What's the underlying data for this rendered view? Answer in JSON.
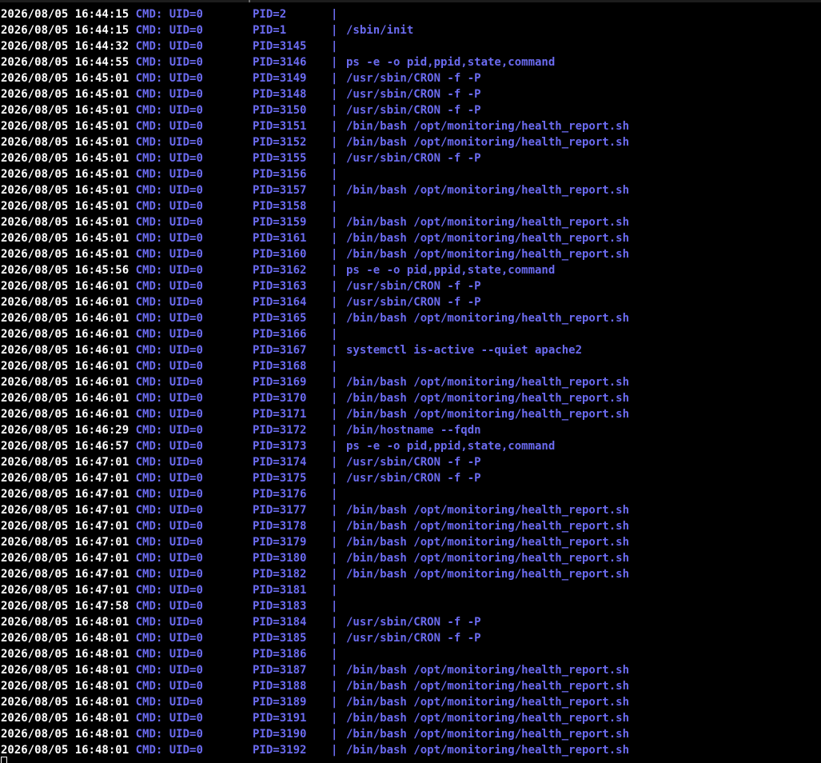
{
  "terminal": {
    "cmd_label": "CMD:",
    "separator": "|",
    "lines": [
      {
        "timestamp": "2026/08/05 16:44:15",
        "uid": "UID=0",
        "pid": "PID=2",
        "command": ""
      },
      {
        "timestamp": "2026/08/05 16:44:15",
        "uid": "UID=0",
        "pid": "PID=1",
        "command": "/sbin/init"
      },
      {
        "timestamp": "2026/08/05 16:44:32",
        "uid": "UID=0",
        "pid": "PID=3145",
        "command": ""
      },
      {
        "timestamp": "2026/08/05 16:44:55",
        "uid": "UID=0",
        "pid": "PID=3146",
        "command": "ps -e -o pid,ppid,state,command"
      },
      {
        "timestamp": "2026/08/05 16:45:01",
        "uid": "UID=0",
        "pid": "PID=3149",
        "command": "/usr/sbin/CRON -f -P"
      },
      {
        "timestamp": "2026/08/05 16:45:01",
        "uid": "UID=0",
        "pid": "PID=3148",
        "command": "/usr/sbin/CRON -f -P"
      },
      {
        "timestamp": "2026/08/05 16:45:01",
        "uid": "UID=0",
        "pid": "PID=3150",
        "command": "/usr/sbin/CRON -f -P"
      },
      {
        "timestamp": "2026/08/05 16:45:01",
        "uid": "UID=0",
        "pid": "PID=3151",
        "command": "/bin/bash /opt/monitoring/health_report.sh"
      },
      {
        "timestamp": "2026/08/05 16:45:01",
        "uid": "UID=0",
        "pid": "PID=3152",
        "command": "/bin/bash /opt/monitoring/health_report.sh"
      },
      {
        "timestamp": "2026/08/05 16:45:01",
        "uid": "UID=0",
        "pid": "PID=3155",
        "command": "/usr/sbin/CRON -f -P"
      },
      {
        "timestamp": "2026/08/05 16:45:01",
        "uid": "UID=0",
        "pid": "PID=3156",
        "command": ""
      },
      {
        "timestamp": "2026/08/05 16:45:01",
        "uid": "UID=0",
        "pid": "PID=3157",
        "command": "/bin/bash /opt/monitoring/health_report.sh"
      },
      {
        "timestamp": "2026/08/05 16:45:01",
        "uid": "UID=0",
        "pid": "PID=3158",
        "command": ""
      },
      {
        "timestamp": "2026/08/05 16:45:01",
        "uid": "UID=0",
        "pid": "PID=3159",
        "command": "/bin/bash /opt/monitoring/health_report.sh"
      },
      {
        "timestamp": "2026/08/05 16:45:01",
        "uid": "UID=0",
        "pid": "PID=3161",
        "command": "/bin/bash /opt/monitoring/health_report.sh"
      },
      {
        "timestamp": "2026/08/05 16:45:01",
        "uid": "UID=0",
        "pid": "PID=3160",
        "command": "/bin/bash /opt/monitoring/health_report.sh"
      },
      {
        "timestamp": "2026/08/05 16:45:56",
        "uid": "UID=0",
        "pid": "PID=3162",
        "command": "ps -e -o pid,ppid,state,command"
      },
      {
        "timestamp": "2026/08/05 16:46:01",
        "uid": "UID=0",
        "pid": "PID=3163",
        "command": "/usr/sbin/CRON -f -P"
      },
      {
        "timestamp": "2026/08/05 16:46:01",
        "uid": "UID=0",
        "pid": "PID=3164",
        "command": "/usr/sbin/CRON -f -P"
      },
      {
        "timestamp": "2026/08/05 16:46:01",
        "uid": "UID=0",
        "pid": "PID=3165",
        "command": "/bin/bash /opt/monitoring/health_report.sh"
      },
      {
        "timestamp": "2026/08/05 16:46:01",
        "uid": "UID=0",
        "pid": "PID=3166",
        "command": ""
      },
      {
        "timestamp": "2026/08/05 16:46:01",
        "uid": "UID=0",
        "pid": "PID=3167",
        "command": "systemctl is-active --quiet apache2"
      },
      {
        "timestamp": "2026/08/05 16:46:01",
        "uid": "UID=0",
        "pid": "PID=3168",
        "command": ""
      },
      {
        "timestamp": "2026/08/05 16:46:01",
        "uid": "UID=0",
        "pid": "PID=3169",
        "command": "/bin/bash /opt/monitoring/health_report.sh"
      },
      {
        "timestamp": "2026/08/05 16:46:01",
        "uid": "UID=0",
        "pid": "PID=3170",
        "command": "/bin/bash /opt/monitoring/health_report.sh"
      },
      {
        "timestamp": "2026/08/05 16:46:01",
        "uid": "UID=0",
        "pid": "PID=3171",
        "command": "/bin/bash /opt/monitoring/health_report.sh"
      },
      {
        "timestamp": "2026/08/05 16:46:29",
        "uid": "UID=0",
        "pid": "PID=3172",
        "command": "/bin/hostname --fqdn"
      },
      {
        "timestamp": "2026/08/05 16:46:57",
        "uid": "UID=0",
        "pid": "PID=3173",
        "command": "ps -e -o pid,ppid,state,command"
      },
      {
        "timestamp": "2026/08/05 16:47:01",
        "uid": "UID=0",
        "pid": "PID=3174",
        "command": "/usr/sbin/CRON -f -P"
      },
      {
        "timestamp": "2026/08/05 16:47:01",
        "uid": "UID=0",
        "pid": "PID=3175",
        "command": "/usr/sbin/CRON -f -P"
      },
      {
        "timestamp": "2026/08/05 16:47:01",
        "uid": "UID=0",
        "pid": "PID=3176",
        "command": ""
      },
      {
        "timestamp": "2026/08/05 16:47:01",
        "uid": "UID=0",
        "pid": "PID=3177",
        "command": "/bin/bash /opt/monitoring/health_report.sh"
      },
      {
        "timestamp": "2026/08/05 16:47:01",
        "uid": "UID=0",
        "pid": "PID=3178",
        "command": "/bin/bash /opt/monitoring/health_report.sh"
      },
      {
        "timestamp": "2026/08/05 16:47:01",
        "uid": "UID=0",
        "pid": "PID=3179",
        "command": "/bin/bash /opt/monitoring/health_report.sh"
      },
      {
        "timestamp": "2026/08/05 16:47:01",
        "uid": "UID=0",
        "pid": "PID=3180",
        "command": "/bin/bash /opt/monitoring/health_report.sh"
      },
      {
        "timestamp": "2026/08/05 16:47:01",
        "uid": "UID=0",
        "pid": "PID=3182",
        "command": "/bin/bash /opt/monitoring/health_report.sh"
      },
      {
        "timestamp": "2026/08/05 16:47:01",
        "uid": "UID=0",
        "pid": "PID=3181",
        "command": ""
      },
      {
        "timestamp": "2026/08/05 16:47:58",
        "uid": "UID=0",
        "pid": "PID=3183",
        "command": ""
      },
      {
        "timestamp": "2026/08/05 16:48:01",
        "uid": "UID=0",
        "pid": "PID=3184",
        "command": "/usr/sbin/CRON -f -P"
      },
      {
        "timestamp": "2026/08/05 16:48:01",
        "uid": "UID=0",
        "pid": "PID=3185",
        "command": "/usr/sbin/CRON -f -P"
      },
      {
        "timestamp": "2026/08/05 16:48:01",
        "uid": "UID=0",
        "pid": "PID=3186",
        "command": ""
      },
      {
        "timestamp": "2026/08/05 16:48:01",
        "uid": "UID=0",
        "pid": "PID=3187",
        "command": "/bin/bash /opt/monitoring/health_report.sh"
      },
      {
        "timestamp": "2026/08/05 16:48:01",
        "uid": "UID=0",
        "pid": "PID=3188",
        "command": "/bin/bash /opt/monitoring/health_report.sh"
      },
      {
        "timestamp": "2026/08/05 16:48:01",
        "uid": "UID=0",
        "pid": "PID=3189",
        "command": "/bin/bash /opt/monitoring/health_report.sh"
      },
      {
        "timestamp": "2026/08/05 16:48:01",
        "uid": "UID=0",
        "pid": "PID=3191",
        "command": "/bin/bash /opt/monitoring/health_report.sh"
      },
      {
        "timestamp": "2026/08/05 16:48:01",
        "uid": "UID=0",
        "pid": "PID=3190",
        "command": "/bin/bash /opt/monitoring/health_report.sh"
      },
      {
        "timestamp": "2026/08/05 16:48:01",
        "uid": "UID=0",
        "pid": "PID=3192",
        "command": "/bin/bash /opt/monitoring/health_report.sh"
      }
    ]
  },
  "colors": {
    "background": "#000000",
    "timestamp": "#ffffff",
    "accent": "#6b6bf0"
  }
}
